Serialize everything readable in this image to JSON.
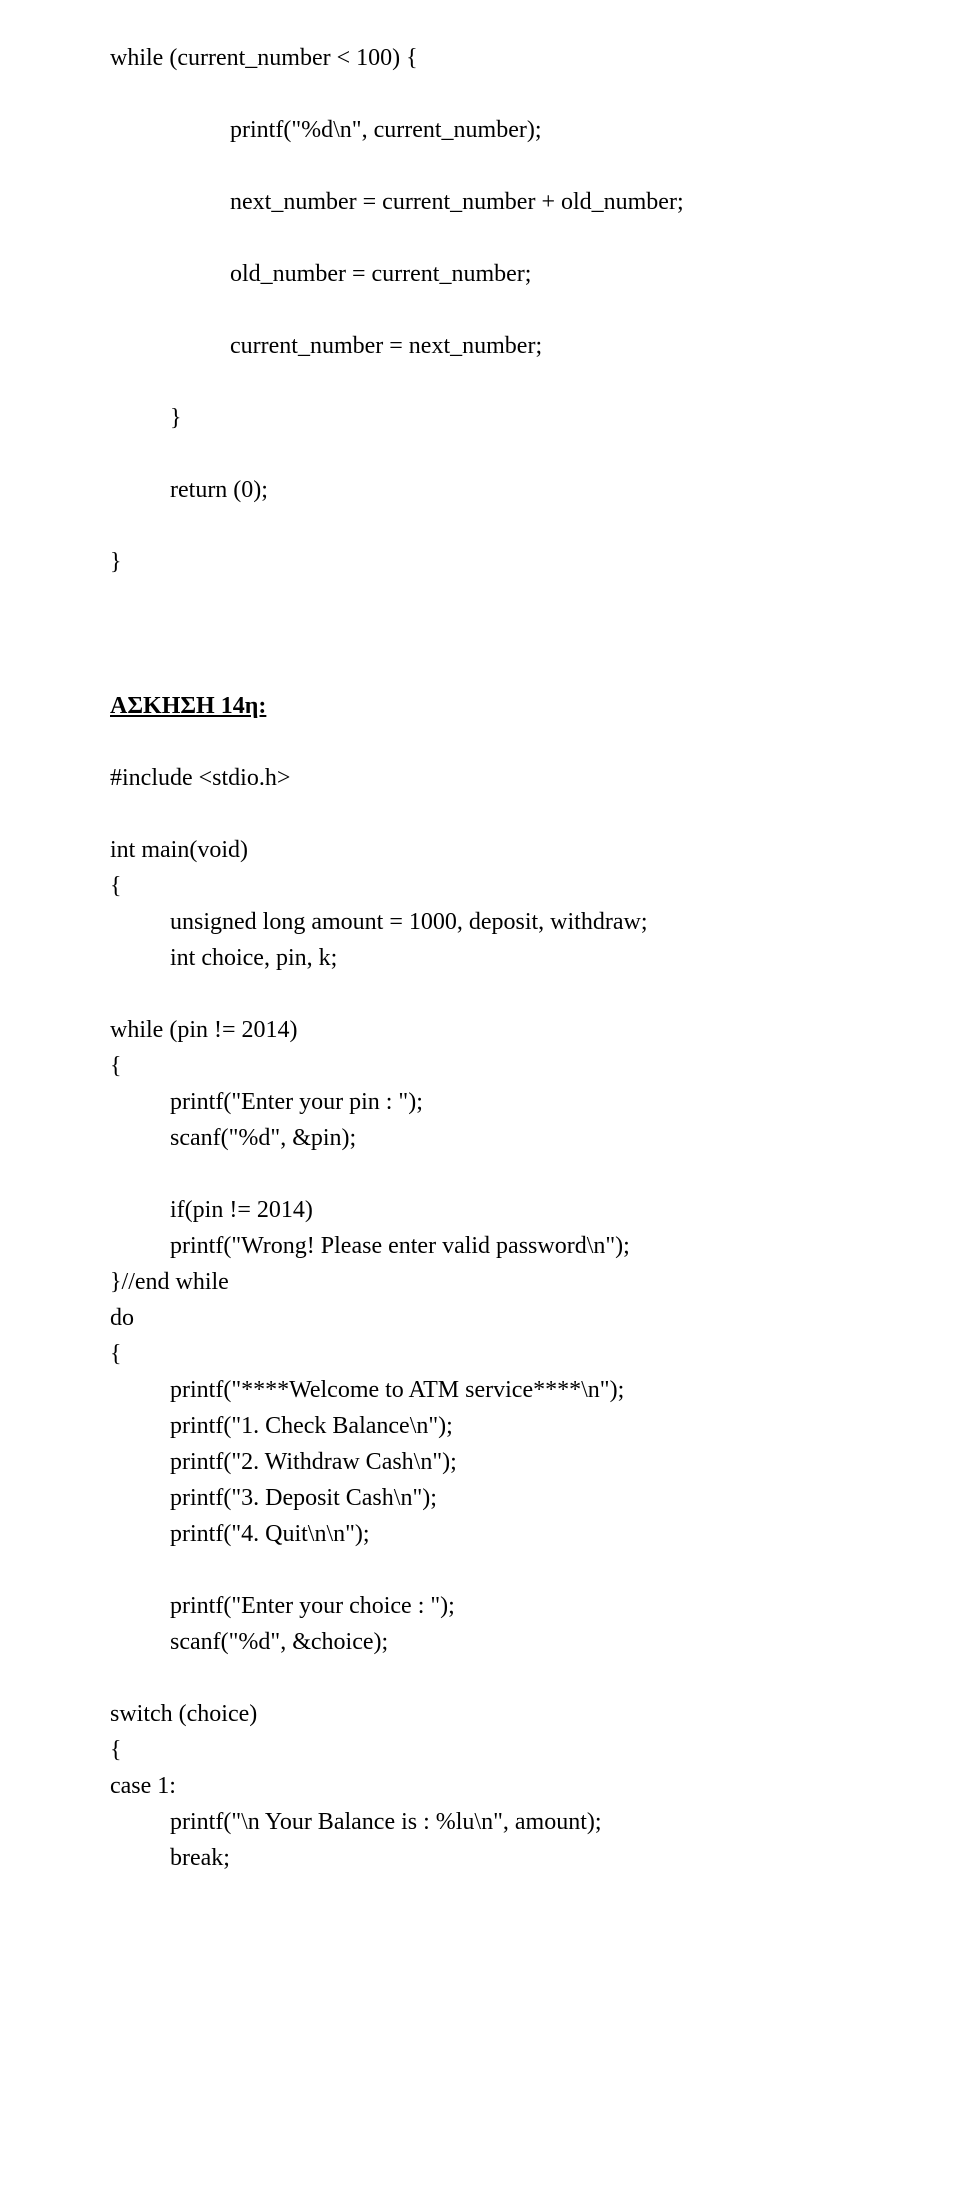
{
  "lines": {
    "l1": "while (current_number < 100) {",
    "l2": "printf(\"%d\\n\", current_number);",
    "l3": "next_number = current_number + old_number;",
    "l4": "old_number = current_number;",
    "l5": "current_number = next_number;",
    "l6": "}",
    "l7": "return (0);",
    "l8": "}",
    "heading": "ΑΣΚΗΣΗ 14η:",
    "l9": "#include <stdio.h>",
    "l10": "int main(void)",
    "l11": "{",
    "l12": "unsigned long amount = 1000, deposit, withdraw;",
    "l13": "int choice, pin, k;",
    "l14": "while (pin != 2014)",
    "l15": "{",
    "l16": "printf(\"Enter your pin : \");",
    "l17": "scanf(\"%d\", &pin);",
    "l18": "if(pin != 2014)",
    "l19": "printf(\"Wrong! Please enter valid password\\n\");",
    "l20": "}//end while",
    "l21": "do",
    "l22": "{",
    "l23": "printf(\"****Welcome to ATM service****\\n\");",
    "l24": "printf(\"1. Check Balance\\n\");",
    "l25": "printf(\"2. Withdraw Cash\\n\");",
    "l26": "printf(\"3. Deposit Cash\\n\");",
    "l27": "printf(\"4. Quit\\n\\n\");",
    "l28": "printf(\"Enter your choice : \");",
    "l29": "scanf(\"%d\", &choice);",
    "l30": "switch (choice)",
    "l31": "{",
    "l32": "case 1:",
    "l33": "printf(\"\\n Your Balance is : %lu\\n\", amount);",
    "l34": "break;"
  }
}
